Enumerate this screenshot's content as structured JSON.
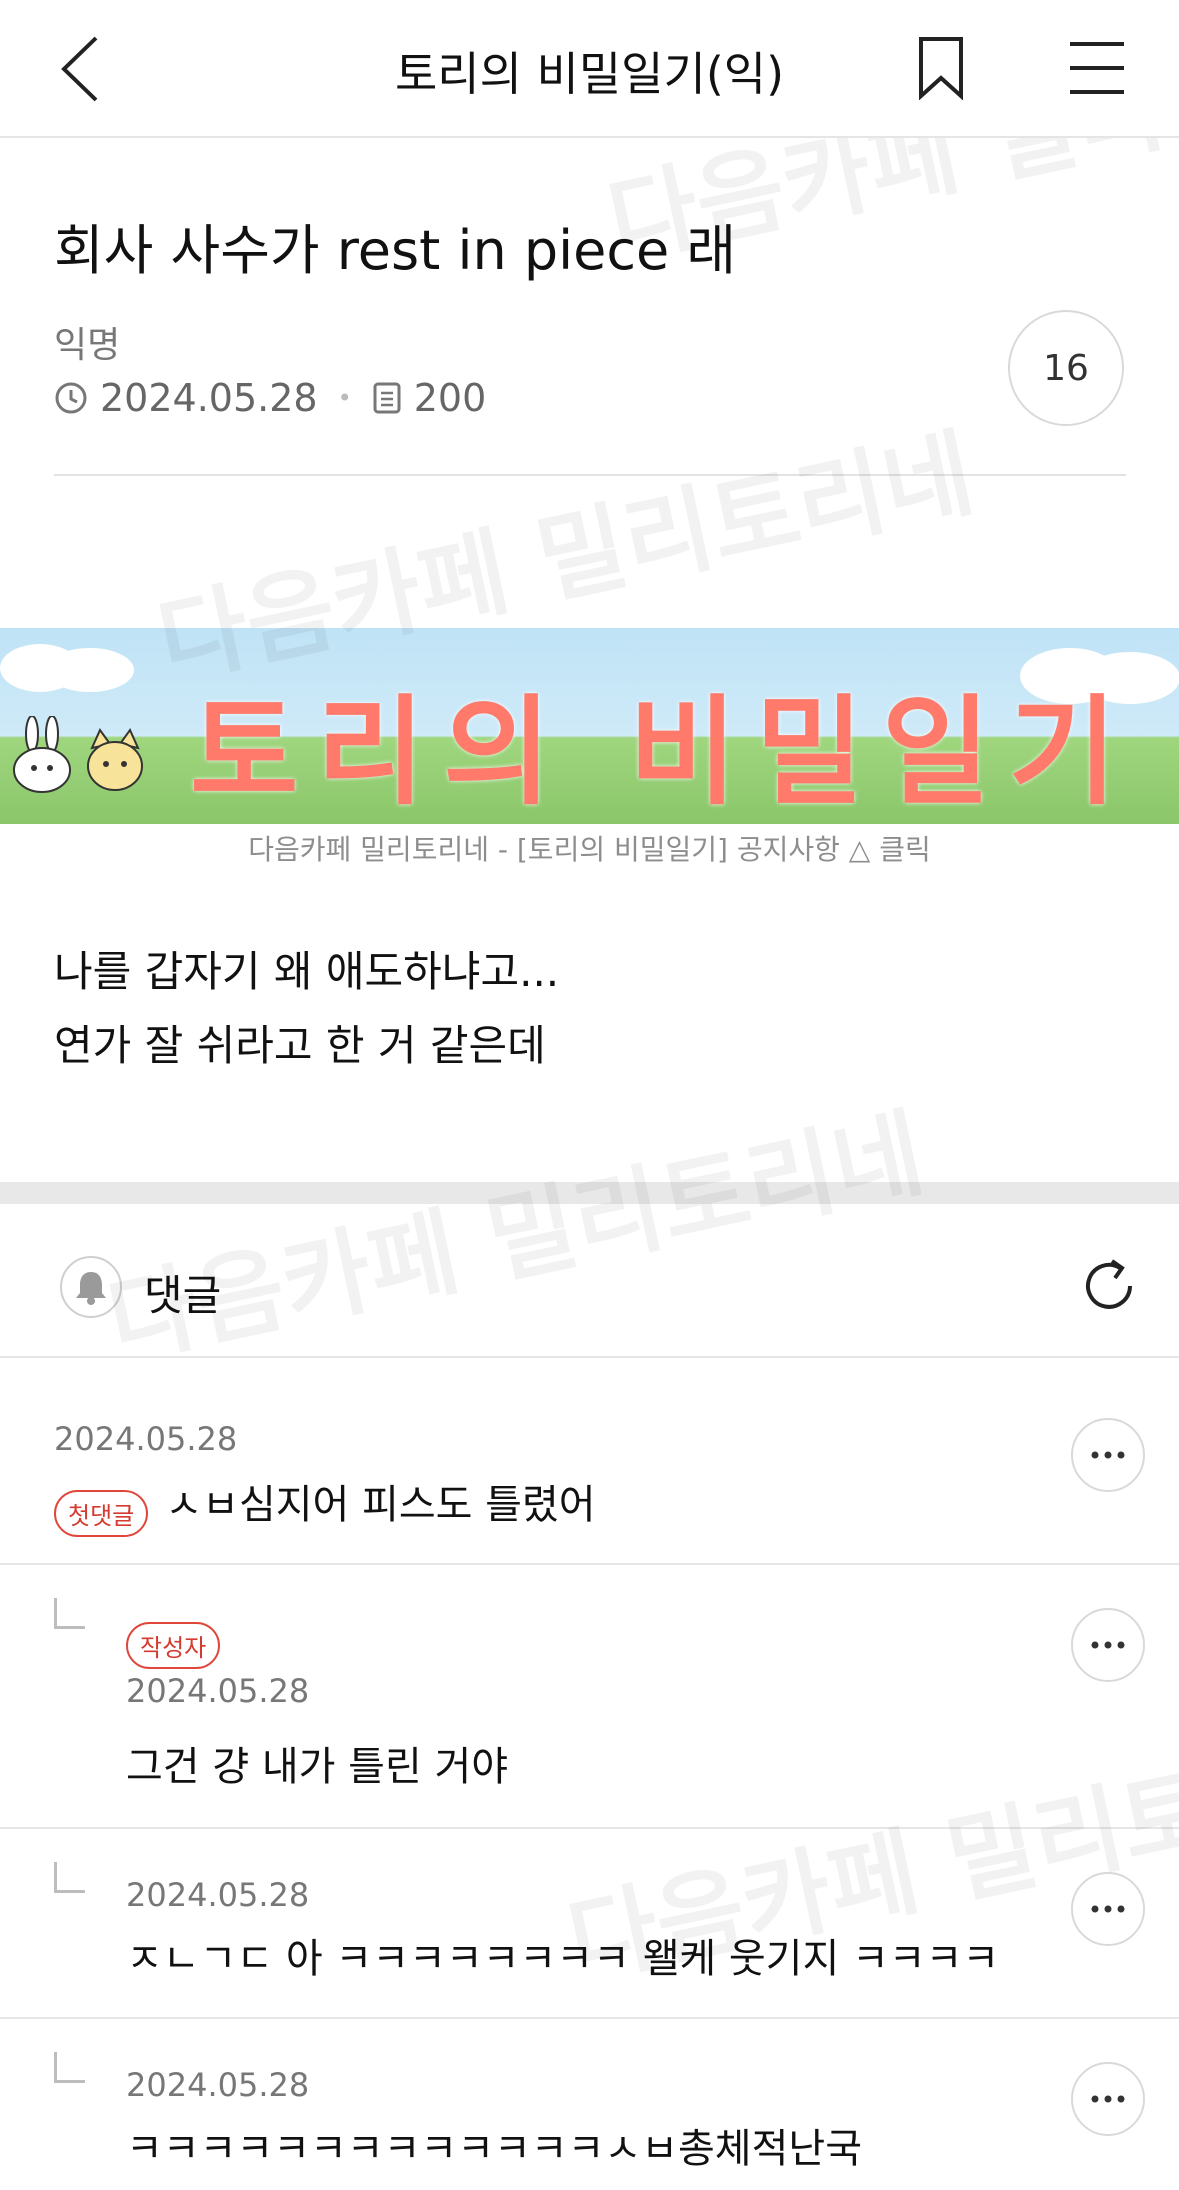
{
  "header": {
    "title": "토리의 비밀일기(익)",
    "back_icon": "chevron-left-icon",
    "bookmark_icon": "bookmark-icon",
    "menu_icon": "hamburger-menu-icon"
  },
  "post": {
    "title": "회사 사수가 rest in piece 래",
    "author": "익명",
    "date": "2024.05.28",
    "views": "200",
    "comment_count": "16",
    "body_lines": [
      "나를 갑자기 왜 애도하냐고...",
      "연가 잘 쉬라고 한 거 같은데"
    ]
  },
  "banner": {
    "text": "토리의 비밀일기",
    "caption": "다음카페 밀리토리네 - [토리의 비밀일기] 공지사항 △ 클릭"
  },
  "comments_section": {
    "label": "댓글",
    "bell_icon": "bell-icon",
    "refresh_icon": "refresh-icon"
  },
  "comments": [
    {
      "date": "2024.05.28",
      "badge": "첫댓글",
      "text": "ㅅㅂ심지어 피스도 틀렸어",
      "reply": false
    },
    {
      "date": "2024.05.28",
      "badge": "작성자",
      "text": "그건 걍 내가 틀린 거야",
      "reply": true
    },
    {
      "date": "2024.05.28",
      "badge": "",
      "text": "ㅈㄴㄱㄷ 아 ㅋㅋㅋㅋㅋㅋㅋㅋ 왤케 웃기지 ㅋㅋㅋㅋ",
      "reply": true
    },
    {
      "date": "2024.05.28",
      "badge": "",
      "text": "ㅋㅋㅋㅋㅋㅋㅋㅋㅋㅋㅋㅋㅋㅅㅂ총체적난국",
      "reply": true
    }
  ],
  "watermark": "다음카페 밀리토리네",
  "colors": {
    "accent_red": "#e0463a",
    "banner_text": "#ff7a6a",
    "divider": "#e6e6e6"
  }
}
